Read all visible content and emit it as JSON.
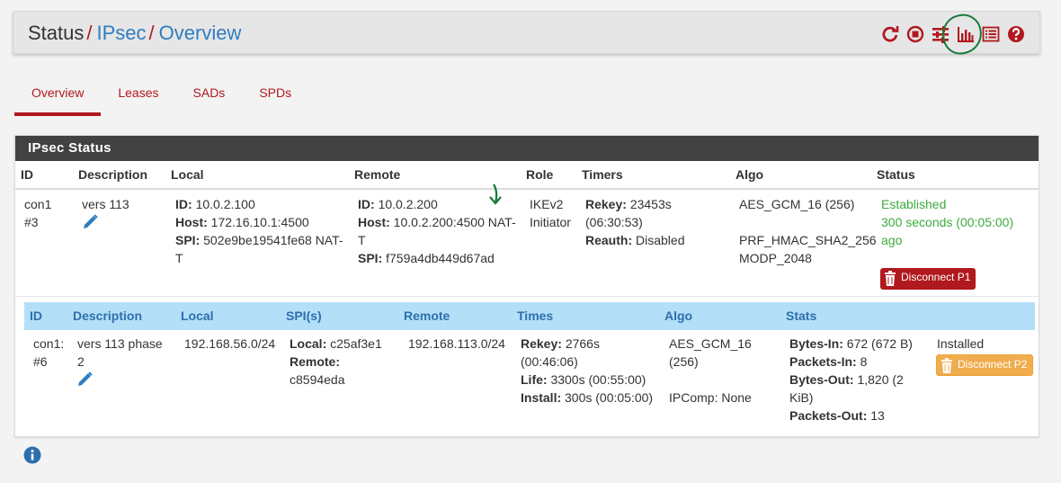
{
  "breadcrumb": {
    "root": "Status",
    "sep": "/",
    "link1": "IPsec",
    "link2": "Overview"
  },
  "toolbar_icons": [
    "refresh-icon",
    "stop-icon",
    "settings-sliders-icon",
    "bar-chart-icon",
    "list-log-icon",
    "help-icon"
  ],
  "colors": {
    "accent": "#b0191e",
    "link": "#2f7cc0",
    "panel_heading": "#424242",
    "phase2_header": "#b3e0f8",
    "established": "#3cab3c",
    "warning": "#f0ad4e"
  },
  "tabs": [
    {
      "label": "Overview",
      "active": true
    },
    {
      "label": "Leases",
      "active": false
    },
    {
      "label": "SADs",
      "active": false
    },
    {
      "label": "SPDs",
      "active": false
    }
  ],
  "panel": {
    "title": "IPsec Status"
  },
  "p1_headers": [
    "ID",
    "Description",
    "Local",
    "Remote",
    "Role",
    "Timers",
    "Algo",
    "Status"
  ],
  "p1": {
    "id_1": "con1",
    "id_2": "#3",
    "description": "vers 113",
    "local": {
      "id_label": "ID:",
      "id": "10.0.2.100",
      "host_label": "Host:",
      "host": "172.16.10.1:4500",
      "spi_label": "SPI:",
      "spi": "502e9be19541fe68 NAT-",
      "spi_wrap": "T"
    },
    "remote": {
      "id_label": "ID:",
      "id": "10.0.2.200",
      "host_label": "Host:",
      "host": "10.0.2.200:4500 NAT-",
      "host_wrap": "T",
      "spi_label": "SPI:",
      "spi": "f759a4db449d67ad"
    },
    "role_1": "IKEv2",
    "role_2": "Initiator",
    "timers": {
      "rekey_label": "Rekey:",
      "rekey": "23453s",
      "rekey_2": "(06:30:53)",
      "reauth_label": "Reauth:",
      "reauth": "Disabled"
    },
    "algo": {
      "line1": "AES_GCM_16 (256)",
      "line2": "PRF_HMAC_SHA2_256",
      "line3": "MODP_2048"
    },
    "status": {
      "line1": "Established",
      "line2": "300 seconds (00:05:00)",
      "line3": "ago"
    },
    "disconnect_label": "Disconnect P1"
  },
  "p2_headers": [
    "ID",
    "Description",
    "Local",
    "SPI(s)",
    "Remote",
    "Times",
    "Algo",
    "Stats"
  ],
  "p2": {
    "id_1": "con1:",
    "id_2": "#6",
    "description_1": "vers 113 phase",
    "description_2": "2",
    "local": "192.168.56.0/24",
    "spi": {
      "local_label": "Local:",
      "local": "c25af3e1",
      "remote_label": "Remote:",
      "remote": "c8594eda"
    },
    "remote": "192.168.113.0/24",
    "times": {
      "rekey_label": "Rekey:",
      "rekey": "2766s",
      "rekey_2": "(00:46:06)",
      "life_label": "Life:",
      "life": "3300s (00:55:00)",
      "install_label": "Install:",
      "install": "300s (00:05:00)"
    },
    "algo": {
      "line1": "AES_GCM_16",
      "line2": "(256)",
      "ipcomp": "IPComp: None"
    },
    "stats": {
      "bytes_in_label": "Bytes-In:",
      "bytes_in": "672 (672 B)",
      "packets_in_label": "Packets-In:",
      "packets_in": "8",
      "bytes_out_label": "Bytes-Out:",
      "bytes_out": "1,820 (2",
      "bytes_out_2": "KiB)",
      "packets_out_label": "Packets-Out:",
      "packets_out": "13"
    },
    "status": "Installed",
    "disconnect_label": "Disconnect P2"
  }
}
